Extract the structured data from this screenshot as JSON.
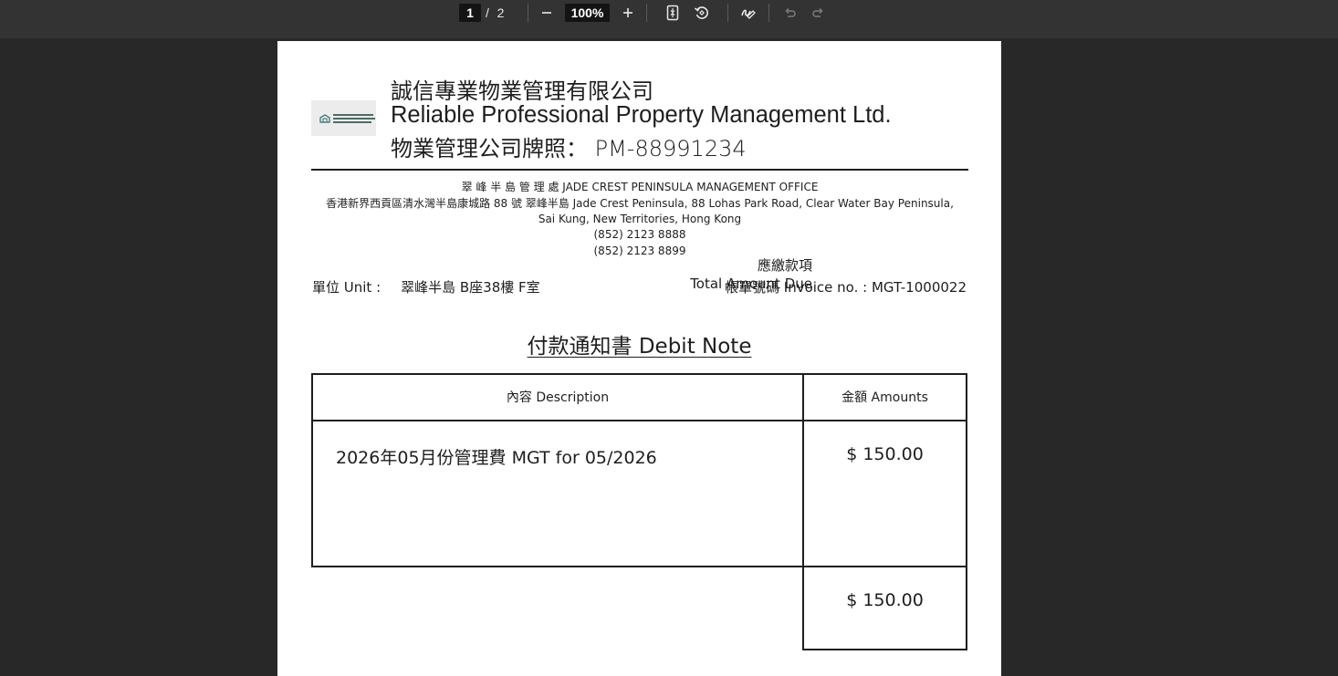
{
  "toolbar": {
    "page_current": "1",
    "page_separator": "/",
    "page_total": "2",
    "zoom": "100%",
    "icons": [
      "zoom-out-icon",
      "zoom-in-icon",
      "fit-page-icon",
      "rotate-icon",
      "draw-icon",
      "undo-icon",
      "redo-icon"
    ]
  },
  "document": {
    "company_zh": "誠信專業物業管理有限公司",
    "company_en": "Reliable Professional Property Management Ltd.",
    "license": "物業管理公司牌照： PM-88991234",
    "office": "翠 峰 半 島 管 理 處 JADE CREST PENINSULA MANAGEMENT OFFICE",
    "address_line1": "香港新界西貢區清水灣半島康城路 88 號 翠峰半島 Jade Crest Peninsula, 88 Lohas Park Road, Clear Water Bay Peninsula,",
    "address_line2": "Sai Kung, New Territories, Hong Kong",
    "phone1": "(852) 2123 8888",
    "phone2": "(852) 2123 8899",
    "unit_label": "單位 Unit :",
    "unit_value": "翠峰半島 B座38樓 F室",
    "invoice": "帳單號碼 Invoice no. : MGT-1000022",
    "title": "付款通知書 Debit Note",
    "table": {
      "header_description": "內容 Description",
      "header_amounts": "金額 Amounts",
      "row_description": "2026年05月份管理費 MGT for 05/2026",
      "row_amount": "$ 150.00",
      "total_label_zh": "應繳款項",
      "total_label_en": "Total Amount Due",
      "total_amount": "$ 150.00"
    }
  },
  "colors": {
    "viewer_background": "#282828",
    "toolbar_background": "#333333",
    "page_background": "#ffffff",
    "text": "#1e1e1e"
  }
}
